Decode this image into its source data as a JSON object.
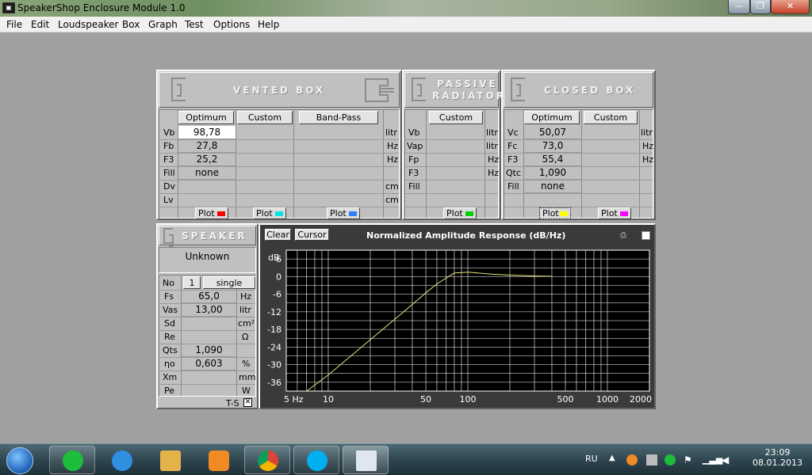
{
  "window": {
    "title": "SpeakerShop Enclosure Module 1.0",
    "minimize": "—",
    "maximize": "❐",
    "close": "✕"
  },
  "menu": [
    "File",
    "Edit",
    "Loudspeaker",
    "Box",
    "Graph",
    "Test",
    "Options",
    "Help"
  ],
  "vented": {
    "title": "VENTED BOX",
    "tabs": [
      "Optimum",
      "Custom",
      "Band-Pass"
    ],
    "rows": [
      {
        "label": "Vb",
        "value": "98,78",
        "unit": "litr"
      },
      {
        "label": "Fb",
        "value": "27,8",
        "unit": "Hz"
      },
      {
        "label": "F3",
        "value": "25,2",
        "unit": "Hz"
      },
      {
        "label": "Fill",
        "value": "none",
        "unit": ""
      },
      {
        "label": "Dv",
        "value": "",
        "unit": "cm"
      },
      {
        "label": "Lv",
        "value": "",
        "unit": "cm"
      }
    ],
    "plot_label": "Plot"
  },
  "passive": {
    "title_line1": "PASSIVE",
    "title_line2": "RADIATOR",
    "tab": "Custom",
    "rows": [
      {
        "label": "Vb",
        "unit": "litr"
      },
      {
        "label": "Vap",
        "unit": "litr"
      },
      {
        "label": "Fp",
        "unit": "Hz"
      },
      {
        "label": "F3",
        "unit": "Hz"
      },
      {
        "label": "Fill",
        "unit": ""
      }
    ],
    "plot_label": "Plot"
  },
  "closed": {
    "title": "CLOSED BOX",
    "tabs": [
      "Optimum",
      "Custom"
    ],
    "rows": [
      {
        "label": "Vc",
        "value": "50,07",
        "unit": "litr"
      },
      {
        "label": "Fc",
        "value": "73,0",
        "unit": "Hz"
      },
      {
        "label": "F3",
        "value": "55,4",
        "unit": "Hz"
      },
      {
        "label": "Qtc",
        "value": "1,090",
        "unit": ""
      },
      {
        "label": "Fill",
        "value": "none",
        "unit": ""
      }
    ],
    "plot_label": "Plot"
  },
  "speaker": {
    "title": "SPEAKER",
    "name": "Unknown",
    "no_label": "No",
    "no_value": "1",
    "no_mode": "single",
    "rows": [
      {
        "label": "Fs",
        "value": "65,0",
        "unit": "Hz"
      },
      {
        "label": "Vas",
        "value": "13,00",
        "unit": "litr"
      },
      {
        "label": "Sd",
        "value": "",
        "unit": "cm²"
      },
      {
        "label": "Re",
        "value": "",
        "unit": "Ω"
      },
      {
        "label": "Qts",
        "value": "1,090",
        "unit": ""
      },
      {
        "label": "ηo",
        "value": "0,603",
        "unit": "%"
      },
      {
        "label": "Xm",
        "value": "",
        "unit": "mm"
      },
      {
        "label": "Pe",
        "value": "",
        "unit": "W"
      }
    ],
    "ts_label": "T-S",
    "ts_mark": "✕"
  },
  "graph": {
    "title": "Normalized Amplitude Response (dB/Hz)",
    "clear_label": "Clear",
    "cursor_label": "Cursor",
    "ylabel": "dB"
  },
  "chart_data": {
    "type": "line",
    "title": "Normalized Amplitude Response (dB/Hz)",
    "xlabel": "",
    "ylabel": "dB",
    "xscale": "log",
    "xlim": [
      5,
      2000
    ],
    "ylim": [
      -39,
      9
    ],
    "x_ticks": [
      "5 Hz",
      "10",
      "50",
      "100",
      "500",
      "1000",
      "2000"
    ],
    "x_tick_values": [
      5,
      10,
      50,
      100,
      500,
      1000,
      2000
    ],
    "y_ticks": [
      6,
      0,
      -6,
      -12,
      -18,
      -24,
      -30,
      -36
    ],
    "y_tick_labels": [
      "6",
      "0",
      "-6",
      "-12",
      "-18",
      "-24",
      "-30",
      "-36"
    ],
    "grid": true,
    "series": [
      {
        "color": "#e8e47a",
        "x": [
          7,
          10,
          20,
          30,
          40,
          50,
          60,
          70,
          80,
          100,
          150,
          200,
          300,
          400
        ],
        "y": [
          -39,
          -33.5,
          -21.5,
          -14.5,
          -9.5,
          -5.5,
          -2.5,
          -0.5,
          1.2,
          1.5,
          0.8,
          0.5,
          0.2,
          0.1
        ]
      }
    ]
  },
  "colors": {
    "plot_vented_optimum": "#ff0000",
    "plot_vented_custom": "#00e5e5",
    "plot_vented_bandpass": "#2f7fff",
    "plot_passive": "#00d000",
    "plot_closed_optimum": "#ffff00",
    "plot_closed_custom": "#ff00ff"
  },
  "taskbar": {
    "lang": "RU",
    "time": "23:09",
    "date": "08.01.2013",
    "apps": [
      "start-icon",
      "mailru-agent-icon",
      "internet-explorer-icon",
      "file-explorer-icon",
      "media-player-icon",
      "chrome-icon",
      "skype-icon",
      "speakershop-icon"
    ]
  }
}
